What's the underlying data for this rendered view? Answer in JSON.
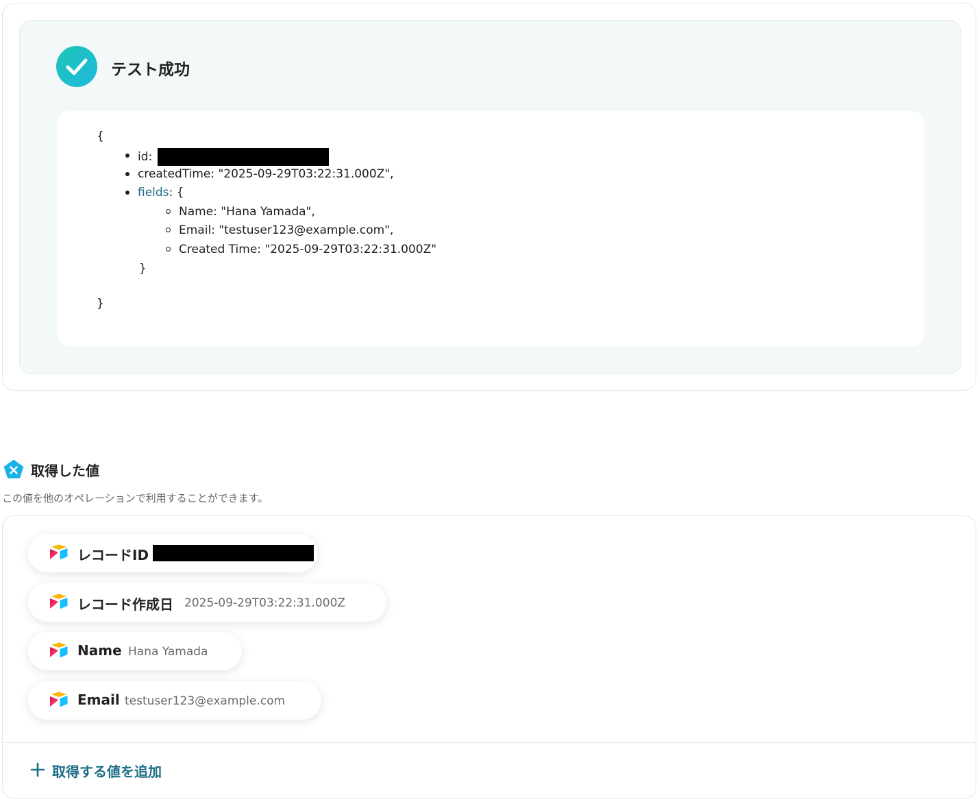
{
  "test_result": {
    "title": "テスト成功",
    "json": {
      "open_brace": "{",
      "id_label": "id:",
      "created_time_line": "createdTime: \"2025-09-29T03:22:31.000Z\",",
      "fields_key": "fields",
      "fields_open": ": {",
      "name_line": "Name: \"Hana Yamada\",",
      "email_line": "Email: \"testuser123@example.com\",",
      "created_line": "Created Time: \"2025-09-29T03:22:31.000Z\"",
      "inner_close": "}",
      "close_brace": "}"
    }
  },
  "values_section": {
    "title": "取得した値",
    "description": "この値を他のオペレーションで利用することができます。",
    "items": [
      {
        "label": "レコードID",
        "value": ""
      },
      {
        "label": "レコード作成日",
        "value": "2025-09-29T03:22:31.000Z"
      },
      {
        "label": "Name",
        "value": "Hana Yamada"
      },
      {
        "label": "Email",
        "value": "testuser123@example.com"
      }
    ],
    "add_button_label": "取得する値を追加"
  },
  "colors": {
    "success_gradient_start": "#1ec6b4",
    "success_gradient_end": "#1fb8e0",
    "link": "#1c6d87",
    "panel_bg": "#f3f8f8"
  },
  "icons": {
    "status": "check-circle-icon",
    "section": "yoom-pentagon-icon",
    "item": "airtable-icon",
    "add": "plus-icon"
  }
}
